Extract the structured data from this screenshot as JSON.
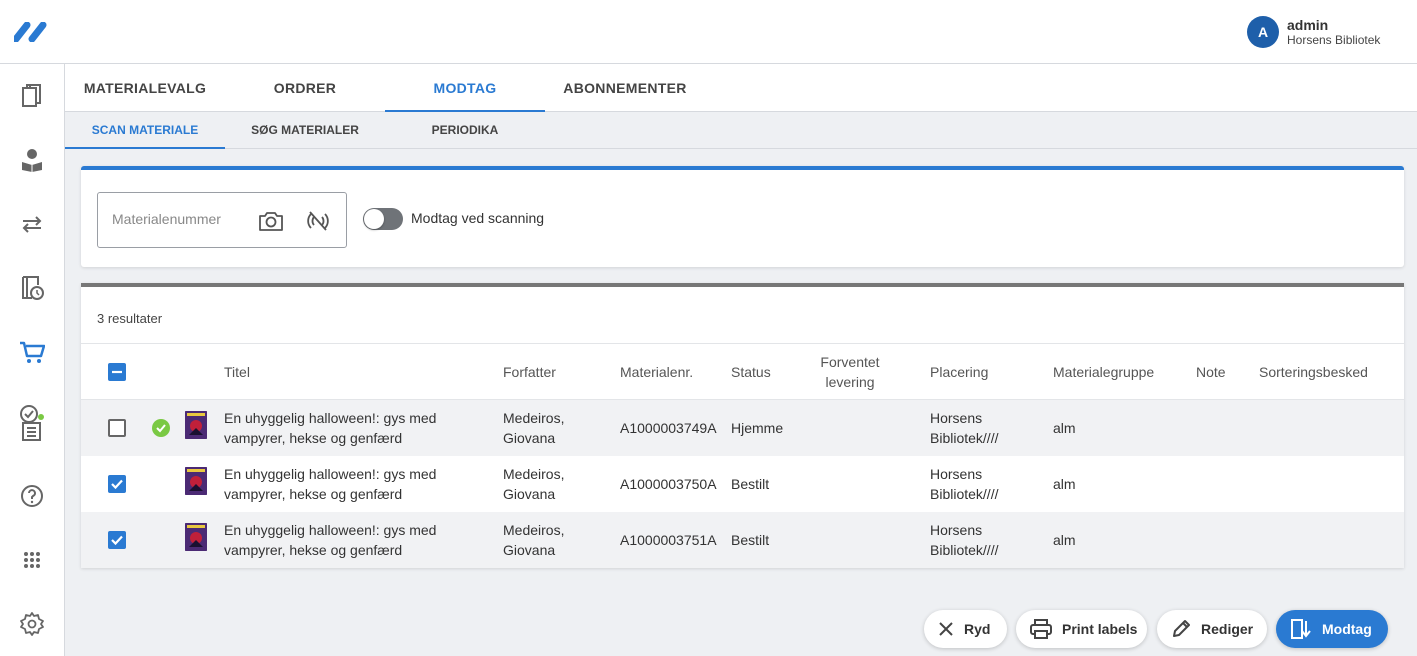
{
  "user": {
    "initial": "A",
    "name": "admin",
    "library": "Horsens Bibliotek"
  },
  "sidebar": {
    "icons": [
      "copies-icon",
      "reader-icon",
      "transfer-icon",
      "loan-history-icon",
      "cart-icon",
      "checklist-icon",
      "help-icon",
      "apps-icon",
      "settings-icon"
    ]
  },
  "tabs": [
    {
      "label": "MATERIALEVALG"
    },
    {
      "label": "ORDRER"
    },
    {
      "label": "MODTAG"
    },
    {
      "label": "ABONNEMENTER"
    }
  ],
  "subtabs": [
    {
      "label": "SCAN MATERIALE"
    },
    {
      "label": "SØG MATERIALER"
    },
    {
      "label": "PERIODIKA"
    }
  ],
  "scan": {
    "placeholder": "Materialenummer",
    "toggle_label": "Modtag ved scanning",
    "toggle_on": false
  },
  "results": {
    "count_label": "3 resultater",
    "columns": {
      "title": "Titel",
      "author": "Forfatter",
      "matnr": "Materialenr.",
      "status": "Status",
      "delivery_1": "Forventet",
      "delivery_2": "levering",
      "placement": "Placering",
      "group": "Materialegruppe",
      "note": "Note",
      "sort": "Sorteringsbesked"
    },
    "rows": [
      {
        "checked": false,
        "received": true,
        "title_1": "En uhyggelig halloween!: gys med",
        "title_2": "vampyrer, hekse og genfærd",
        "author_1": "Medeiros,",
        "author_2": "Giovana",
        "matnr": "A1000003749A",
        "status": "Hjemme",
        "placement_1": "Horsens",
        "placement_2": "Bibliotek////",
        "group": "alm"
      },
      {
        "checked": true,
        "received": false,
        "title_1": "En uhyggelig halloween!: gys med",
        "title_2": "vampyrer, hekse og genfærd",
        "author_1": "Medeiros,",
        "author_2": "Giovana",
        "matnr": "A1000003750A",
        "status": "Bestilt",
        "placement_1": "Horsens",
        "placement_2": "Bibliotek////",
        "group": "alm"
      },
      {
        "checked": true,
        "received": false,
        "title_1": "En uhyggelig halloween!: gys med",
        "title_2": "vampyrer, hekse og genfærd",
        "author_1": "Medeiros,",
        "author_2": "Giovana",
        "matnr": "A1000003751A",
        "status": "Bestilt",
        "placement_1": "Horsens",
        "placement_2": "Bibliotek////",
        "group": "alm"
      }
    ]
  },
  "actions": {
    "clear": "Ryd",
    "print": "Print labels",
    "edit": "Rediger",
    "receive": "Modtag"
  },
  "colors": {
    "accent": "#2a7ad2",
    "success": "#7ac943",
    "avatar": "#1e5faa"
  }
}
